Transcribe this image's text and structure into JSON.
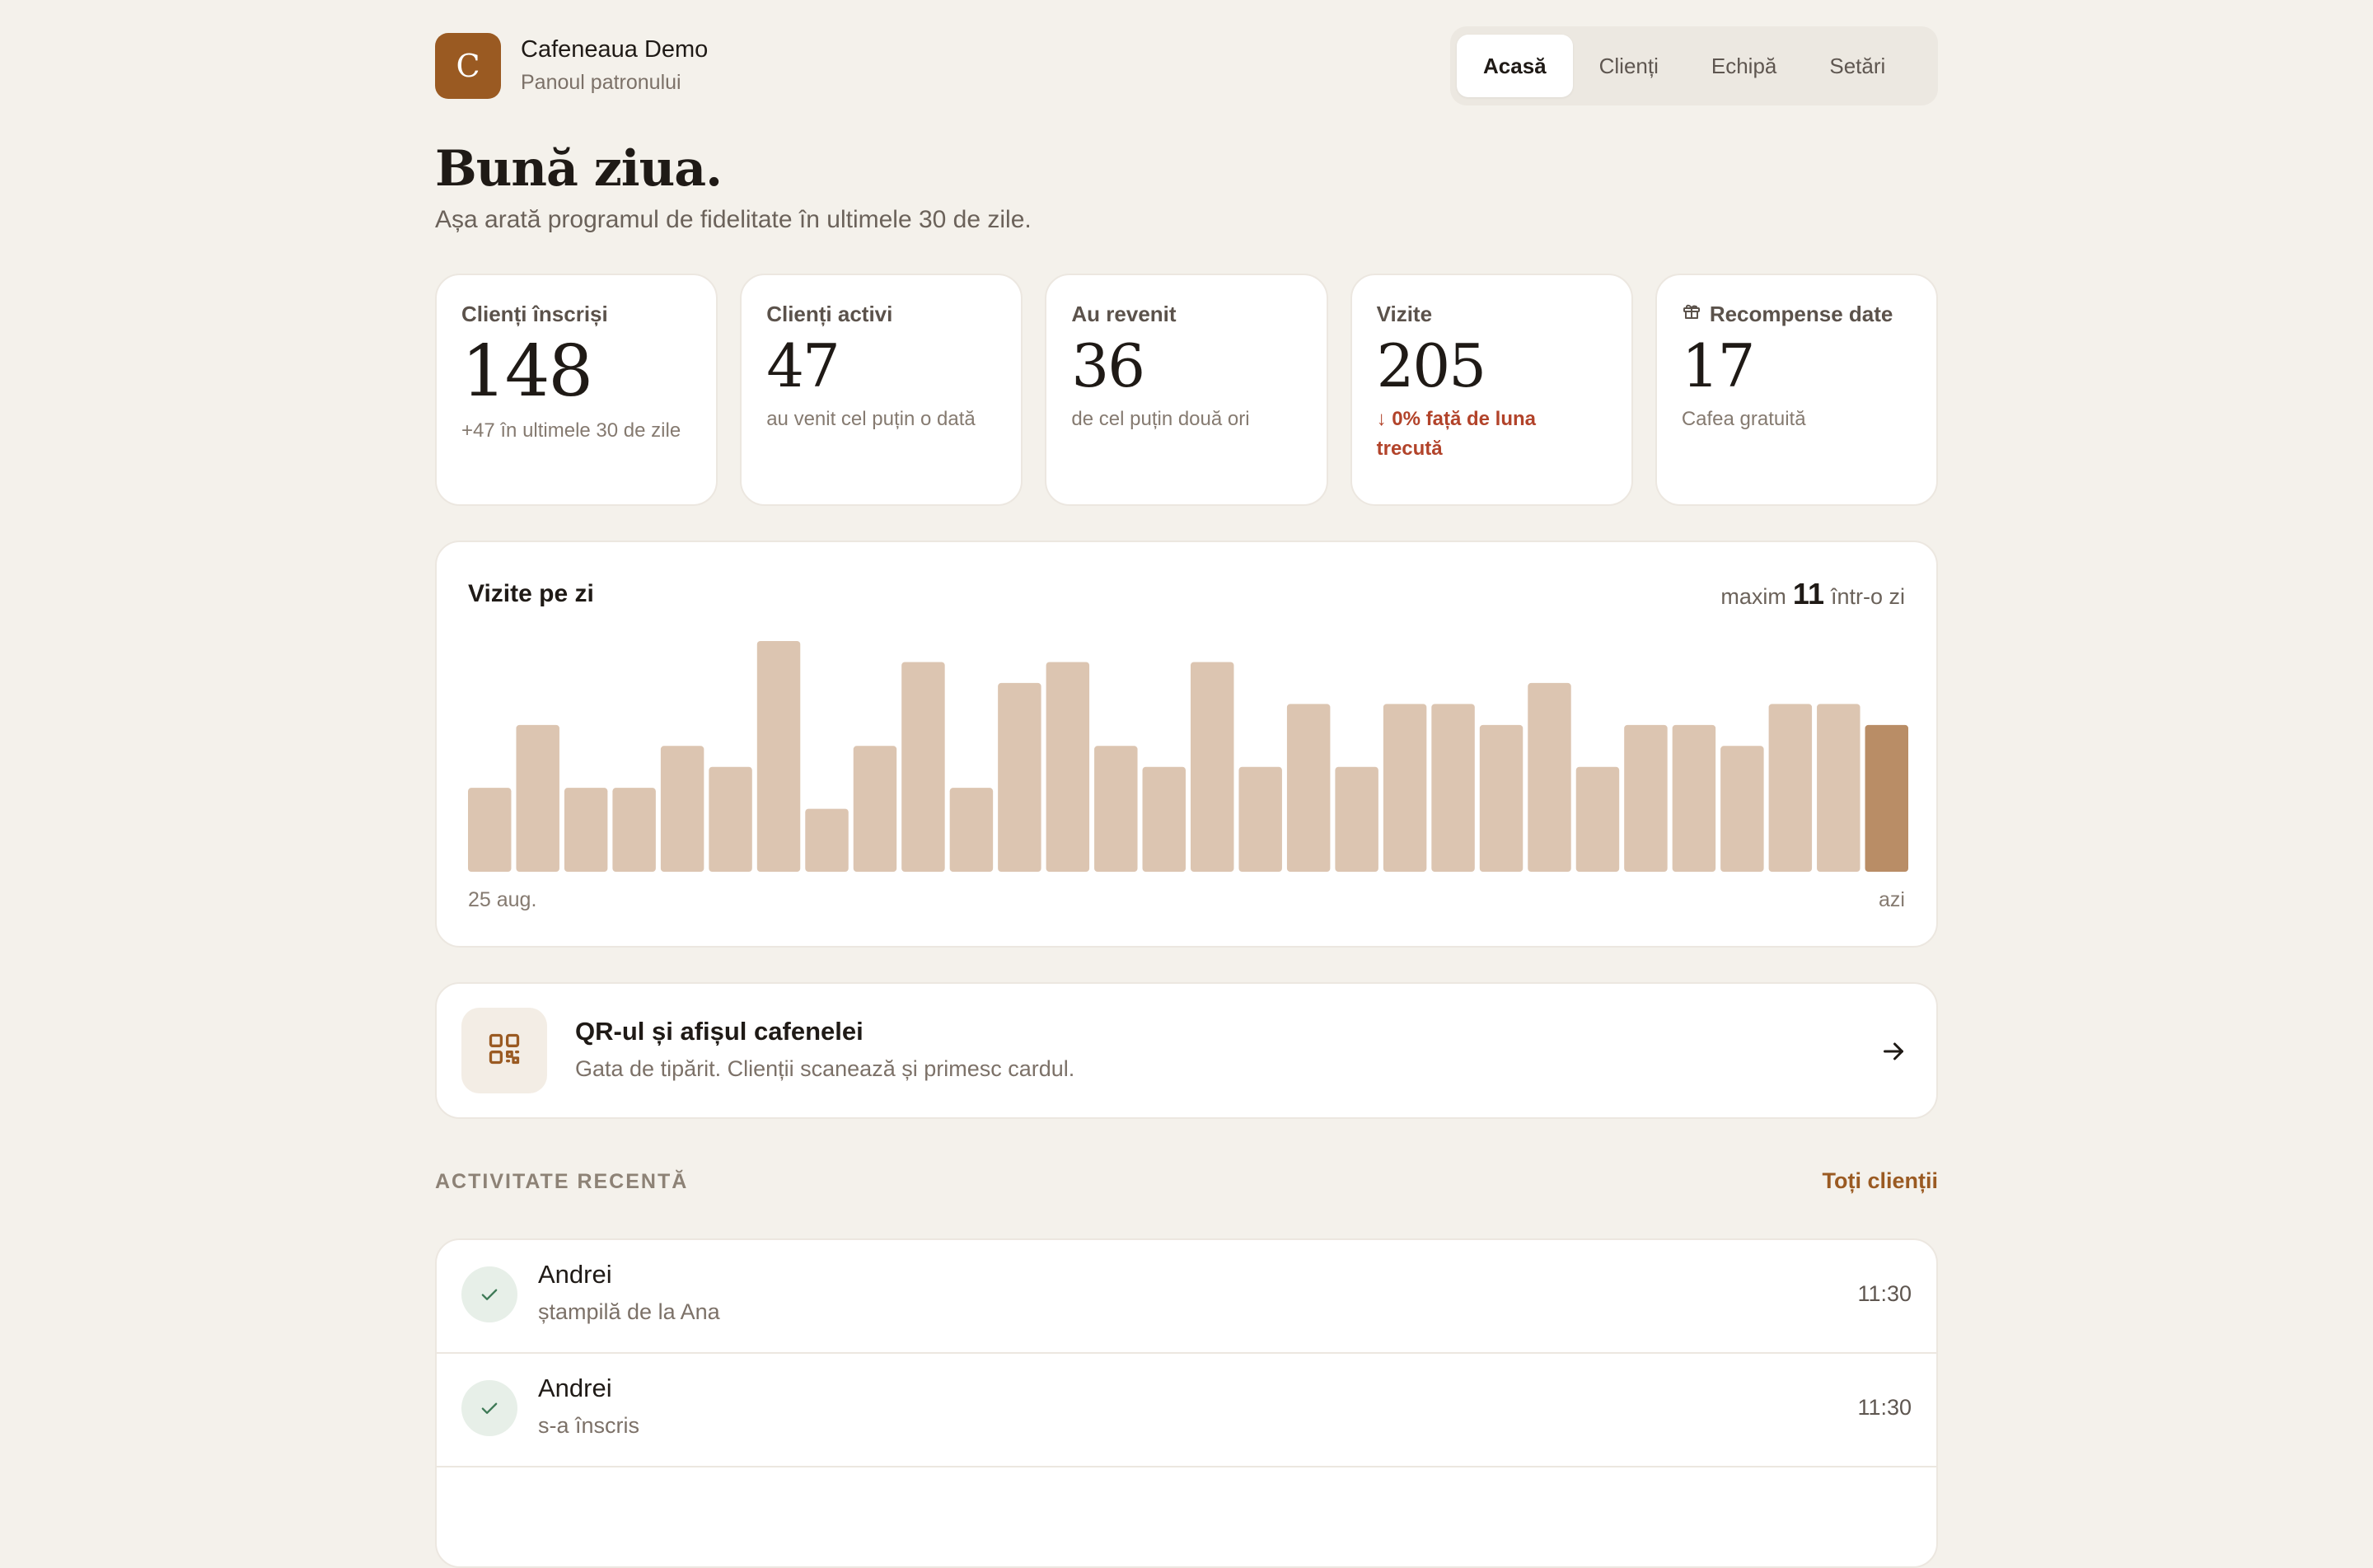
{
  "header": {
    "logo_letter": "C",
    "brand_name": "Cafeneaua Demo",
    "brand_sub": "Panoul patronului",
    "nav": [
      {
        "label": "Acasă",
        "active": true
      },
      {
        "label": "Clienți",
        "active": false
      },
      {
        "label": "Echipă",
        "active": false
      },
      {
        "label": "Setări",
        "active": false
      }
    ]
  },
  "greeting": {
    "title": "Bună ziua.",
    "subtitle": "Așa arată programul de fidelitate în ultimele 30 de zile."
  },
  "stats": [
    {
      "label": "Clienți înscriși",
      "value": "148",
      "note": "+47 în ultimele 30 de zile"
    },
    {
      "label": "Clienți activi",
      "value": "47",
      "note": "au venit cel puțin o dată"
    },
    {
      "label": "Au revenit",
      "value": "36",
      "note": "de cel puțin două ori"
    },
    {
      "label": "Vizite",
      "value": "205",
      "note": "↓ 0% față de luna trecută"
    },
    {
      "label": "Recompense date",
      "value": "17",
      "note": "Cafea gratuită",
      "icon": "gift-icon"
    }
  ],
  "chart": {
    "title": "Vizite pe zi",
    "max_prefix": "maxim",
    "max_value": "11",
    "max_suffix": "într-o zi",
    "start_label": "25 aug.",
    "end_label": "azi"
  },
  "chart_data": {
    "type": "bar",
    "title": "Vizite pe zi",
    "values": [
      4,
      7,
      4,
      4,
      6,
      5,
      11,
      3,
      6,
      10,
      4,
      9,
      10,
      6,
      5,
      10,
      5,
      8,
      5,
      8,
      8,
      7,
      9,
      5,
      7,
      7,
      6,
      8,
      8,
      7
    ],
    "ylim": [
      0,
      11
    ],
    "x_start": "25 aug.",
    "x_end": "azi",
    "colors": {
      "bar": "#dcc5b1",
      "today": "#b98d66"
    }
  },
  "qr": {
    "title": "QR-ul și afișul cafenelei",
    "subtitle": "Gata de tipărit. Clienții scanează și primesc cardul.",
    "icon": "qr-code-icon"
  },
  "recent": {
    "heading": "ACTIVITATE RECENTĂ",
    "link": "Toți clienții",
    "items": [
      {
        "name": "Andrei",
        "desc": "ștampilă de la Ana",
        "time": "11:30"
      },
      {
        "name": "Andrei",
        "desc": "s-a înscris",
        "time": "11:30"
      }
    ]
  }
}
